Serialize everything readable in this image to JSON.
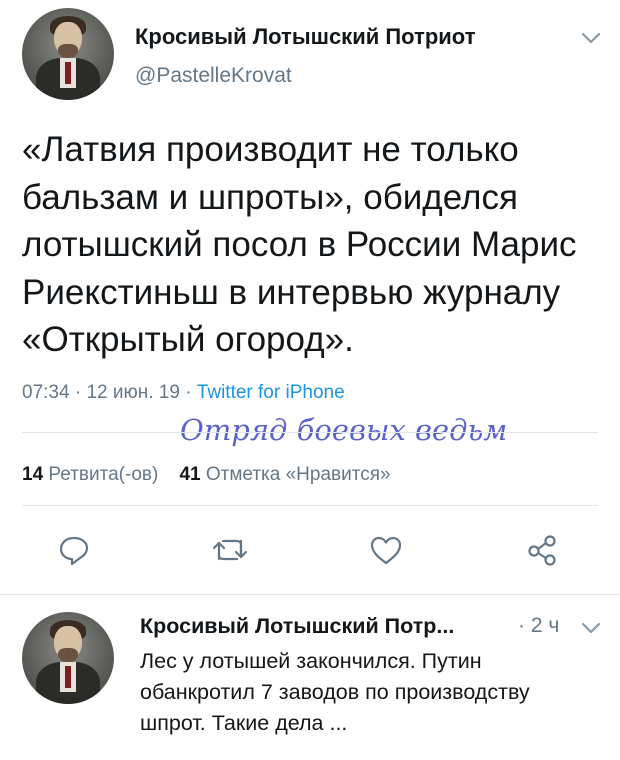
{
  "tweet": {
    "author_name": "Кросивый Лотышский Потриот",
    "author_handle": "@PastelleKrovat",
    "text": "«Латвия производит не только бальзам и шпроты», обиделся лотышский посол в России Марис Риекстиньш в интервью журналу «Открытый огород».",
    "time": "07:34",
    "date": "12 июн. 19",
    "separator": "·",
    "client": "Twitter for iPhone",
    "watermark": "Отряд боевых ведьм",
    "retweets_count": "14",
    "retweets_label": "Ретвита(-ов)",
    "likes_count": "41",
    "likes_label": "Отметка «Нравится»"
  },
  "actions": {
    "reply_icon": "comment-icon",
    "retweet_icon": "retweet-icon",
    "like_icon": "heart-icon",
    "share_icon": "share-icon"
  },
  "reply": {
    "author_name": "Кросивый Лотышский Потр...",
    "time_sep": "·",
    "time": "2 ч",
    "text": "Лес у лотышей закончился. Путин обанкротил 7 заводов по производству шпрот. Такие дела ..."
  },
  "colors": {
    "text": "#14171a",
    "secondary": "#657786",
    "link": "#1b95e0",
    "watermark": "#5b62c7",
    "divider": "#e1e8ed"
  }
}
